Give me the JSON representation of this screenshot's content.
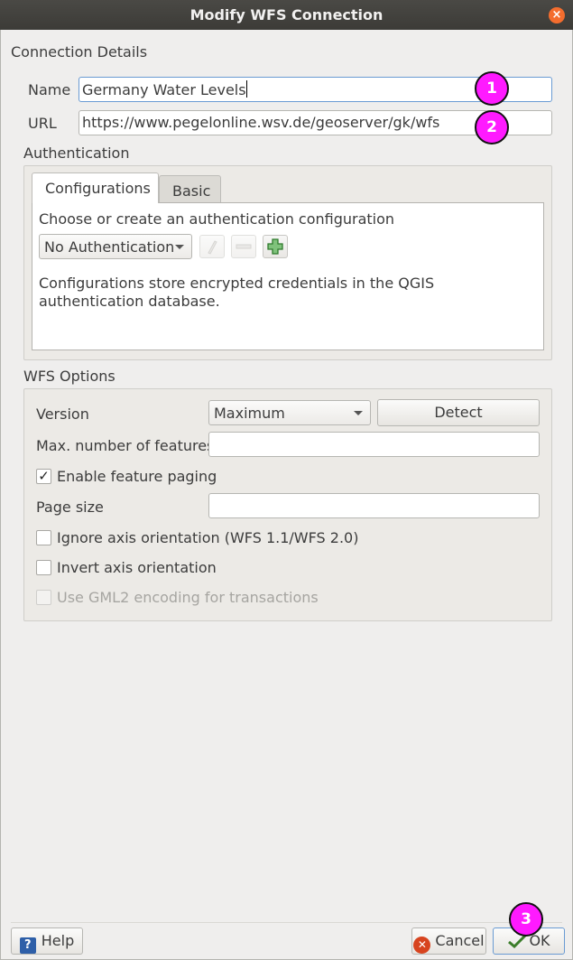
{
  "window": {
    "title": "Modify WFS Connection",
    "close_glyph": "×"
  },
  "connection": {
    "group_title": "Connection Details",
    "name_label": "Name",
    "name_value": "Germany Water Levels",
    "url_label": "URL",
    "url_value": "https://www.pegelonline.wsv.de/geoserver/gk/wfs"
  },
  "authentication": {
    "group_title": "Authentication",
    "tabs": [
      "Configurations",
      "Basic"
    ],
    "active_tab": "Configurations",
    "prompt": "Choose or create an authentication configuration",
    "selected_config": "No Authentication",
    "note": "Configurations store encrypted credentials in the QGIS authentication database.",
    "icons": [
      "edit-pencil-icon",
      "remove-minus-icon",
      "add-plus-icon"
    ]
  },
  "wfs_options": {
    "group_title": "WFS Options",
    "version_label": "Version",
    "version_value": "Maximum",
    "detect_label": "Detect",
    "max_features_label": "Max. number of features",
    "max_features_value": "",
    "enable_paging_label": "Enable feature paging",
    "enable_paging_checked": true,
    "page_size_label": "Page size",
    "page_size_value": "",
    "ignore_axis_label": "Ignore axis orientation (WFS 1.1/WFS 2.0)",
    "ignore_axis_checked": false,
    "invert_axis_label": "Invert axis orientation",
    "invert_axis_checked": false,
    "gml2_label": "Use GML2 encoding for transactions",
    "gml2_checked": false,
    "gml2_enabled": false
  },
  "footer": {
    "help_label": "Help",
    "cancel_label": "Cancel",
    "ok_label": "OK"
  },
  "annotations": [
    "1",
    "2",
    "3"
  ],
  "colors": {
    "badge": "#ff1aff",
    "titlebar": "#3c3b37",
    "close": "#f46d2e"
  }
}
